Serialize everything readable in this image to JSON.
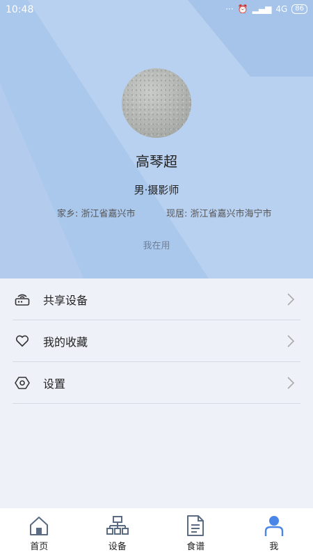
{
  "status_bar": {
    "time": "10:48",
    "network": "4G",
    "battery": "86"
  },
  "profile": {
    "name": "高琴超",
    "role": "男·摄影师",
    "hometown": "家乡: 浙江省嘉兴市",
    "residence": "现居: 浙江省嘉兴市海宁市",
    "status": "我在用"
  },
  "menu": {
    "items": [
      {
        "label": "共享设备",
        "icon": "router-icon"
      },
      {
        "label": "我的收藏",
        "icon": "heart-icon"
      },
      {
        "label": "设置",
        "icon": "hexagon-settings-icon"
      }
    ]
  },
  "tabbar": {
    "tabs": [
      {
        "label": "首页",
        "icon": "home-icon"
      },
      {
        "label": "设备",
        "icon": "device-network-icon"
      },
      {
        "label": "食谱",
        "icon": "recipe-document-icon"
      },
      {
        "label": "我",
        "icon": "person-icon",
        "active": true
      }
    ]
  },
  "colors": {
    "header_bg": "#aac7ec",
    "accent": "#4a86e8",
    "page_bg": "#eef1f8"
  }
}
